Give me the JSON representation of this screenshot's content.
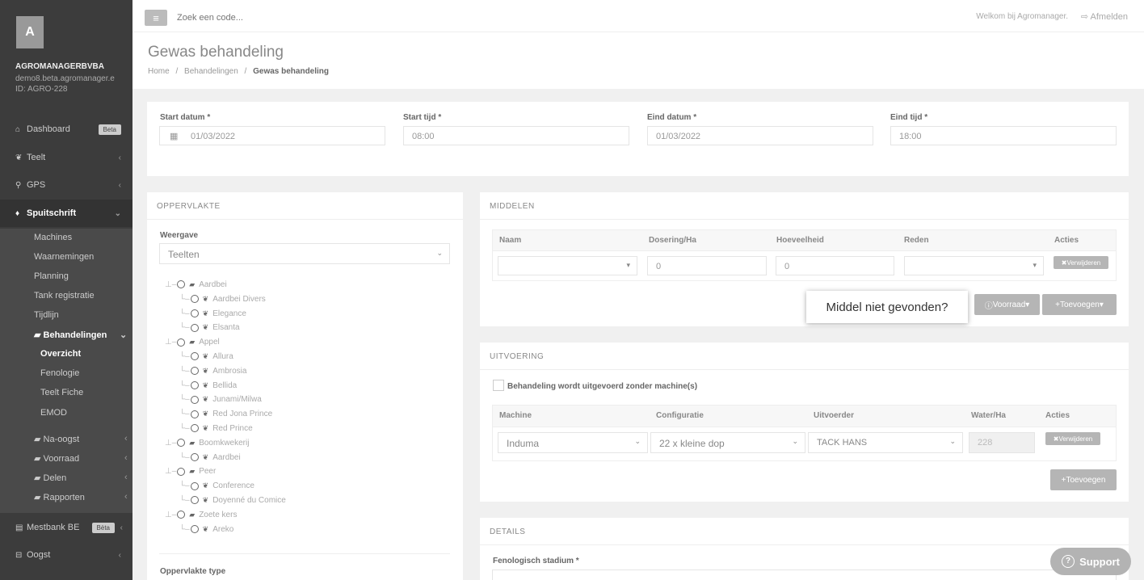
{
  "sidebar": {
    "avatar": "A",
    "org": "AGROMANAGERBVBA",
    "email": "demo8.beta.agromanager.e",
    "org_id": "ID: AGRO-228",
    "items": [
      {
        "label": "Dashboard",
        "badge": "Beta",
        "icon": "home-icon"
      },
      {
        "label": "Teelt",
        "icon": "leaf-icon"
      },
      {
        "label": "GPS",
        "icon": "map-marker-icon"
      },
      {
        "label": "Spuitschrift",
        "icon": "drop-icon"
      },
      {
        "label": "Mestbank BE",
        "badge": "Bèta",
        "icon": "book-icon"
      },
      {
        "label": "Oogst",
        "icon": "basket-icon"
      }
    ],
    "sub_items": [
      "Machines",
      "Waarnemingen",
      "Planning",
      "Tank registratie",
      "Tijdlijn",
      "Behandelingen"
    ],
    "sub2_items": [
      "Overzicht",
      "Fenologie",
      "Teelt Fiche",
      "EMOD"
    ],
    "folder_items": [
      "Na-oogst",
      "Voorraad",
      "Delen",
      "Rapporten"
    ]
  },
  "topbar": {
    "search_placeholder": "Zoek een code...",
    "welcome": "Welkom bij Agromanager.",
    "logout": "Afmelden"
  },
  "header": {
    "title": "Gewas behandeling",
    "crumb_home": "Home",
    "crumb_sep": "/",
    "crumb_mid": "Behandelingen",
    "crumb_current": "Gewas behandeling"
  },
  "dates": {
    "start_date_label": "Start datum *",
    "start_date": "01/03/2022",
    "start_time_label": "Start tijd *",
    "start_time": "08:00",
    "end_date_label": "Eind datum *",
    "end_date": "01/03/2022",
    "end_time_label": "Eind tijd *",
    "end_time": "18:00"
  },
  "oppervlakte": {
    "heading": "OPPERVLAKTE",
    "weergave_label": "Weergave",
    "weergave_value": "Teelten",
    "type_label": "Oppervlakte type",
    "tree": [
      {
        "label": "Aardbei",
        "level": 0
      },
      {
        "label": "Aardbei Divers",
        "level": 1
      },
      {
        "label": "Elegance",
        "level": 1
      },
      {
        "label": "Elsanta",
        "level": 1
      },
      {
        "label": "Appel",
        "level": 0
      },
      {
        "label": "Allura",
        "level": 1
      },
      {
        "label": "Ambrosia",
        "level": 1
      },
      {
        "label": "Bellida",
        "level": 1
      },
      {
        "label": "Junami/Milwa",
        "level": 1
      },
      {
        "label": "Red Jona Prince",
        "level": 1
      },
      {
        "label": "Red Prince",
        "level": 1
      },
      {
        "label": "Boomkwekerij",
        "level": 0
      },
      {
        "label": "Aardbei",
        "level": 1
      },
      {
        "label": "Peer",
        "level": 0
      },
      {
        "label": "Conference",
        "level": 1
      },
      {
        "label": "Doyenné du Comice",
        "level": 1
      },
      {
        "label": "Zoete kers",
        "level": 0
      },
      {
        "label": "Areko",
        "level": 1
      }
    ]
  },
  "middelen": {
    "heading": "MIDDELEN",
    "col_naam": "Naam",
    "col_dosering": "Dosering/Ha",
    "col_hoeveelheid": "Hoeveelheid",
    "col_reden": "Reden",
    "col_acties": "Acties",
    "dosering_value": "0",
    "hoeveelheid_value": "0",
    "remove_label": "Verwijderen",
    "voorraad_label": "Voorraad",
    "toevoegen_label": "Toevoegen",
    "tooltip": "Middel niet gevonden?"
  },
  "uitvoering": {
    "heading": "UITVOERING",
    "checkbox_label": "Behandeling wordt uitgevoerd zonder machine(s)",
    "col_machine": "Machine",
    "col_configuratie": "Configuratie",
    "col_uitvoerder": "Uitvoerder",
    "col_water": "Water/Ha",
    "col_acties": "Acties",
    "machine": "Induma",
    "configuratie": "22 x kleine dop",
    "uitvoerder": "TACK HANS",
    "water": "228",
    "remove_label": "Verwijderen",
    "toevoegen_label": "Toevoegen"
  },
  "details": {
    "heading": "DETAILS",
    "fenologisch_label": "Fenologisch stadium *"
  },
  "support_label": "Support"
}
